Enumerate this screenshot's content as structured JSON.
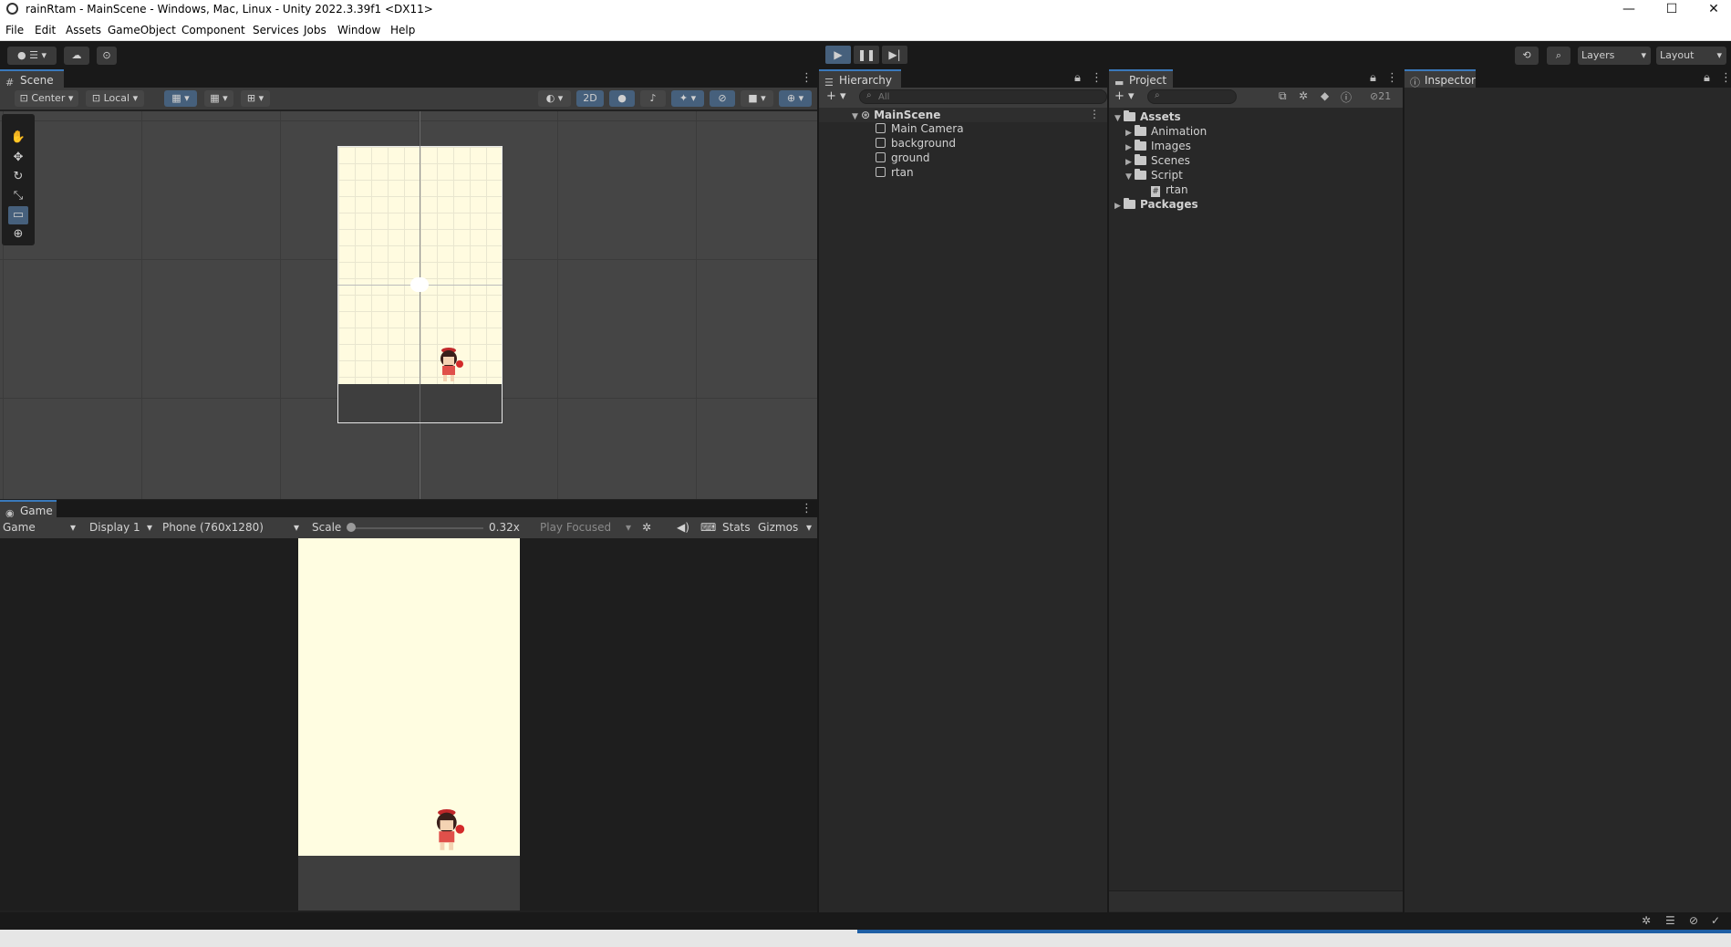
{
  "window": {
    "title": "rainRtam - MainScene - Windows, Mac, Linux - Unity 2022.3.39f1 <DX11>",
    "minimize": "—",
    "maximize": "☐",
    "close": "✕"
  },
  "menu": [
    "File",
    "Edit",
    "Assets",
    "GameObject",
    "Component",
    "Services",
    "Jobs",
    "Window",
    "Help"
  ],
  "toolbar": {
    "layers_label": "Layers",
    "layout_label": "Layout",
    "play_icon": "▶",
    "pause_icon": "❚❚",
    "step_icon": "▶|"
  },
  "scene": {
    "tab_label": "Scene",
    "pivot_label": "Center",
    "space_label": "Local",
    "mode_2d_label": "2D"
  },
  "game": {
    "tab_label": "Game",
    "view_label": "Game",
    "display_label": "Display 1",
    "resolution_label": "Phone (760x1280)",
    "scale_label": "Scale",
    "scale_value": "0.32x",
    "play_focused_label": "Play Focused",
    "stats_label": "Stats",
    "gizmos_label": "Gizmos"
  },
  "hierarchy": {
    "tab_label": "Hierarchy",
    "search_placeholder": "All",
    "scene_name": "MainScene",
    "items": [
      "Main Camera",
      "background",
      "ground",
      "rtan"
    ]
  },
  "project": {
    "tab_label": "Project",
    "badge_count": "21",
    "root": "Assets",
    "folders": [
      "Animation",
      "Images",
      "Scenes",
      "Script"
    ],
    "script_file": "rtan",
    "packages": "Packages"
  },
  "inspector": {
    "tab_label": "Inspector"
  },
  "colors": {
    "accent": "#3a79bb",
    "scene_bg": "#454545",
    "camera_bg": "#fffbe0",
    "ground": "#3e3e3e"
  }
}
